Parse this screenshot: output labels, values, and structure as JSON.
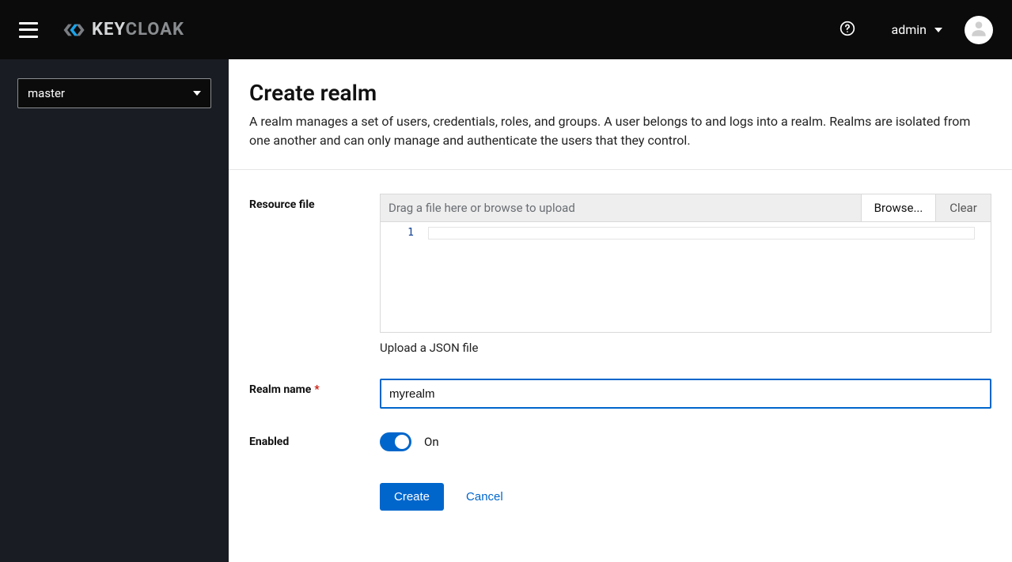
{
  "header": {
    "brand_strong": "KEY",
    "brand_rest": "CLOAK",
    "user_label": "admin"
  },
  "sidebar": {
    "realm_selected": "master"
  },
  "page": {
    "title": "Create realm",
    "description": "A realm manages a set of users, credentials, roles, and groups. A user belongs to and logs into a realm. Realms are isolated from one another and can only manage and authenticate the users that they control."
  },
  "form": {
    "resource_file": {
      "label": "Resource file",
      "placeholder": "Drag a file here or browse to upload",
      "browse_label": "Browse...",
      "clear_label": "Clear",
      "editor_line_number": "1",
      "helper": "Upload a JSON file"
    },
    "realm_name": {
      "label": "Realm name",
      "value": "myrealm"
    },
    "enabled": {
      "label": "Enabled",
      "state_label": "On",
      "value": true
    },
    "actions": {
      "create": "Create",
      "cancel": "Cancel"
    }
  }
}
